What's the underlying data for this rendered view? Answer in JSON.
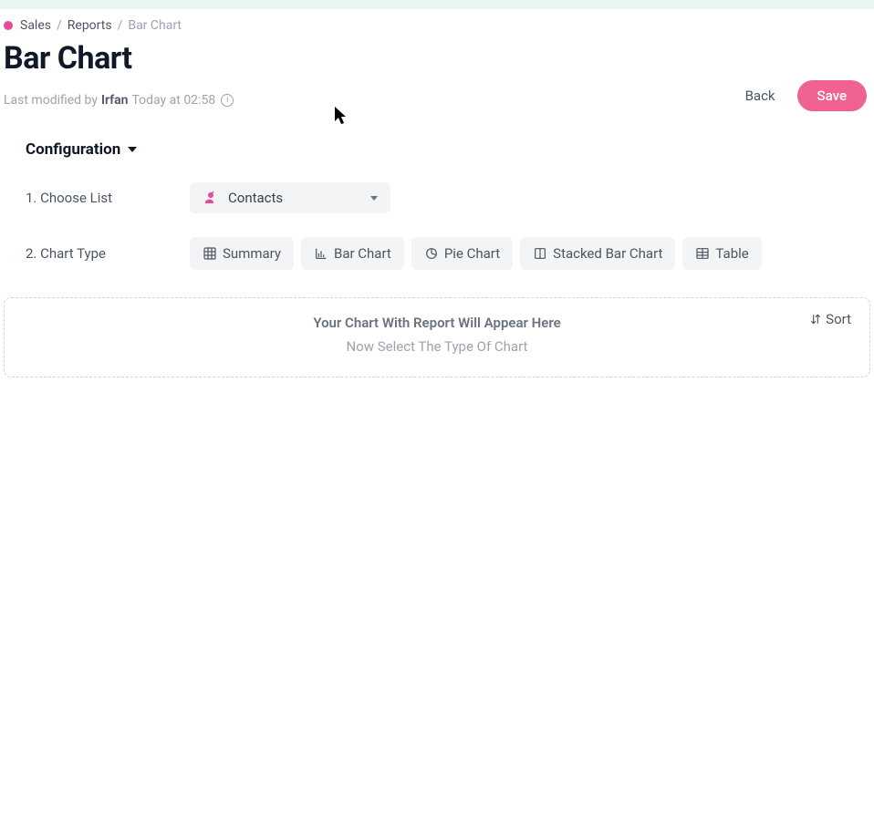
{
  "breadcrumb": {
    "items": [
      "Sales",
      "Reports"
    ],
    "current": "Bar Chart"
  },
  "page": {
    "title": "Bar Chart",
    "modified_prefix": "Last modified by",
    "modified_user": "Irfan",
    "modified_time": "Today at 02:58"
  },
  "actions": {
    "back": "Back",
    "save": "Save"
  },
  "config": {
    "header": "Configuration",
    "choose_list": {
      "label": "1. Choose List",
      "selected": "Contacts"
    },
    "chart_type": {
      "label": "2. Chart Type",
      "options": [
        {
          "label": "Summary"
        },
        {
          "label": "Bar Chart"
        },
        {
          "label": "Pie Chart"
        },
        {
          "label": "Stacked Bar Chart"
        },
        {
          "label": "Table"
        }
      ]
    }
  },
  "placeholder": {
    "title": "Your Chart With Report Will Appear Here",
    "sub": "Now Select The Type Of Chart",
    "sort": "Sort"
  }
}
